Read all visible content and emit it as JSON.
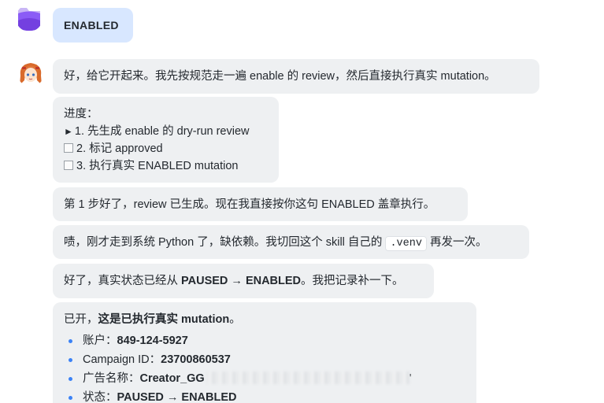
{
  "messages": {
    "user": {
      "text": "ENABLED"
    },
    "m1": {
      "text": "好，给它开起来。我先按规范走一遍 enable 的 review，然后直接执行真实 mutation。"
    },
    "m2": {
      "heading": "进度：",
      "steps": [
        {
          "marker": "►",
          "text": "1. 先生成 enable 的 dry-run review",
          "state": "current"
        },
        {
          "marker": "box",
          "text": "2. 标记 approved",
          "state": "pending"
        },
        {
          "marker": "box",
          "text": "3. 执行真实 ENABLED mutation",
          "state": "pending"
        }
      ]
    },
    "m3": {
      "text": "第 1 步好了，review 已生成。现在我直接按你这句 ENABLED 盖章执行。"
    },
    "m4": {
      "before": "啧，刚才走到系统 Python 了，缺依赖。我切回这个 skill 自己的",
      "code": ".venv",
      "after": "再发一次。"
    },
    "m5": {
      "before": "好了，真实状态已经从",
      "bold": "PAUSED → ENABLED",
      "after": "。我把记录补一下。"
    },
    "m6": {
      "intro_plain": "已开，",
      "intro_bold": "这是已执行真实 mutation",
      "intro_end": "。",
      "details": [
        {
          "label": "账户：",
          "value": "849-124-5927"
        },
        {
          "label": "Campaign ID：",
          "value": "23700860537"
        },
        {
          "label": "广告名称：",
          "value": "Creator_GG",
          "redacted_suffix": "'"
        },
        {
          "label": "状态：",
          "value": "PAUSED → ENABLED"
        }
      ]
    }
  },
  "colors": {
    "user_bubble": "#d8e7ff",
    "bot_bubble": "#eef0f2",
    "bullet": "#3b82f6",
    "user_avatar": "#8b5cf6"
  },
  "icons": {
    "user_avatar": "purple-folder-avatar-icon",
    "bot_avatar": "anime-girl-avatar-icon"
  }
}
